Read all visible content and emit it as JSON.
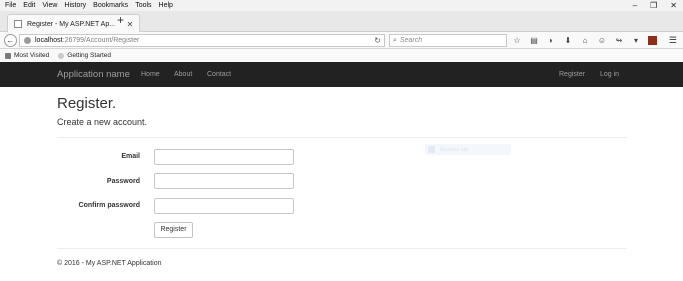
{
  "menubar": {
    "items": [
      "File",
      "Edit",
      "View",
      "History",
      "Bookmarks",
      "Tools",
      "Help"
    ]
  },
  "window_controls": {
    "minimize": "–",
    "restore": "❐",
    "close": "✕"
  },
  "tab": {
    "title": "Register - My ASP.NET Ap...",
    "close": "✕",
    "new_tab": "+"
  },
  "url": {
    "host": "localhost",
    "path": ":26799/Account/Register"
  },
  "search": {
    "placeholder": "Search"
  },
  "bookmarks": [
    "Most Visited",
    "Getting Started"
  ],
  "site": {
    "brand": "Application name",
    "nav_left": [
      "Home",
      "About",
      "Contact"
    ],
    "nav_right": [
      "Register",
      "Log in"
    ]
  },
  "page": {
    "title": "Register.",
    "subtitle": "Create a new account."
  },
  "form": {
    "email_label": "Email",
    "password_label": "Password",
    "confirm_label": "Confirm password",
    "submit": "Register"
  },
  "ghost_text": "Restore tab",
  "footer": "© 2016 - My ASP.NET Application",
  "icons": {
    "back": "arrow-left-icon",
    "reload": "reload-icon",
    "search": "search-icon",
    "bookmark_star": "star-icon",
    "reader": "reading-list-icon",
    "pocket": "pocket-icon",
    "download": "download-icon",
    "home": "home-icon",
    "emoji": "emoji-icon",
    "extension_a": "extension-icon",
    "extension_b": "extension-red-icon",
    "menu": "hamburger-menu-icon"
  },
  "colors": {
    "site_nav_bg": "#222222",
    "nav_text": "#9d9d9d",
    "extension": "#8b2e1a"
  }
}
